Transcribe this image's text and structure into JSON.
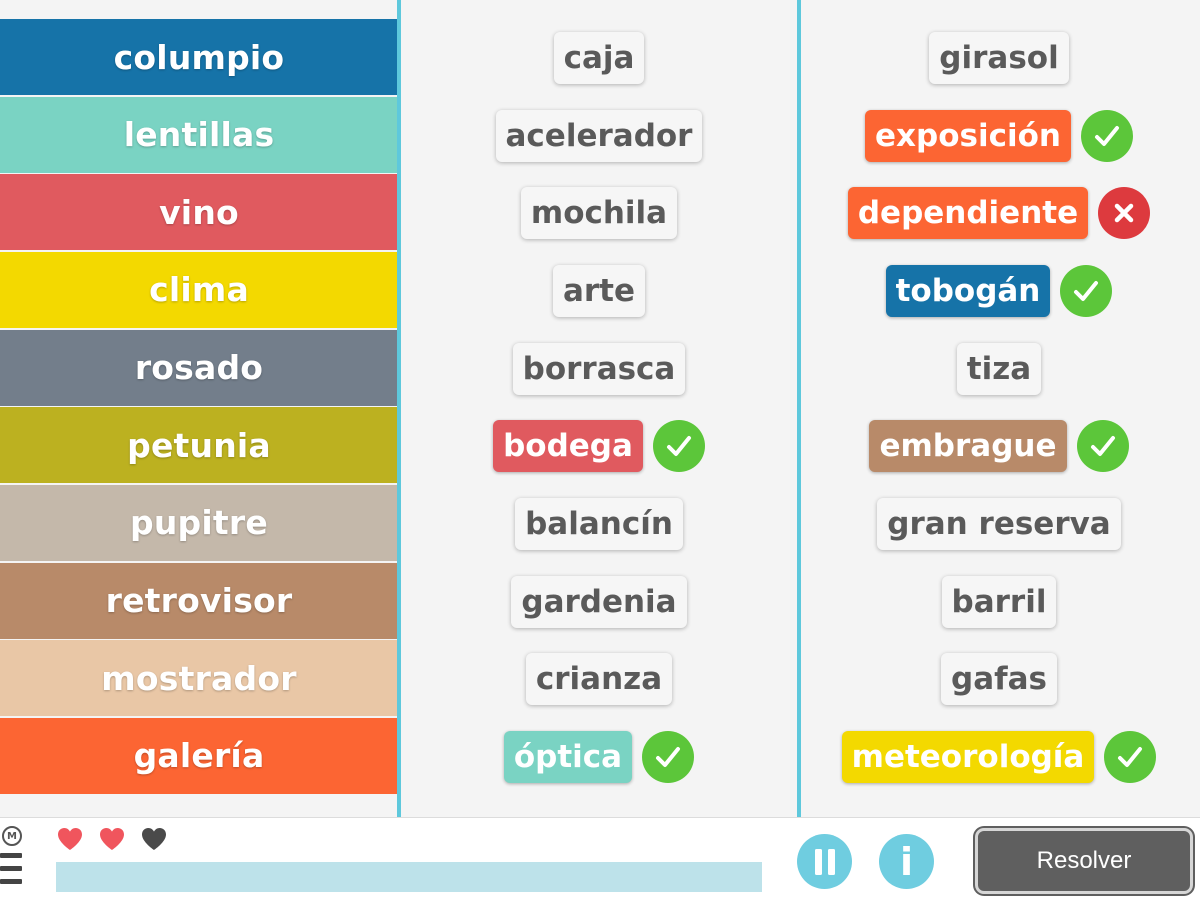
{
  "categories": [
    {
      "label": "columpio",
      "color": "#1673a8"
    },
    {
      "label": "lentillas",
      "color": "#7ad3c3"
    },
    {
      "label": "vino",
      "color": "#e05a5f"
    },
    {
      "label": "clima",
      "color": "#f3d900"
    },
    {
      "label": "rosado",
      "color": "#737e8b"
    },
    {
      "label": "petunia",
      "color": "#bcb120"
    },
    {
      "label": "pupitre",
      "color": "#c4b8aa"
    },
    {
      "label": "retrovisor",
      "color": "#b88a69"
    },
    {
      "label": "mostrador",
      "color": "#e9c7a6"
    },
    {
      "label": "galería",
      "color": "#fc6533"
    }
  ],
  "column_middle": [
    {
      "word": "caja"
    },
    {
      "word": "acelerador"
    },
    {
      "word": "mochila"
    },
    {
      "word": "arte"
    },
    {
      "word": "borrasca"
    },
    {
      "word": "bodega",
      "color": "#e05a5f",
      "mark": "check"
    },
    {
      "word": "balancín"
    },
    {
      "word": "gardenia"
    },
    {
      "word": "crianza"
    },
    {
      "word": "óptica",
      "color": "#7ad3c3",
      "mark": "check"
    }
  ],
  "column_right": [
    {
      "word": "girasol"
    },
    {
      "word": "exposición",
      "color": "#fc6533",
      "mark": "check"
    },
    {
      "word": "dependiente",
      "color": "#fc6533",
      "mark": "cross"
    },
    {
      "word": "tobogán",
      "color": "#1673a8",
      "mark": "check"
    },
    {
      "word": "tiza"
    },
    {
      "word": "embrague",
      "color": "#b88a69",
      "mark": "check"
    },
    {
      "word": "gran reserva"
    },
    {
      "word": "barril"
    },
    {
      "word": "gafas"
    },
    {
      "word": "meteorología",
      "color": "#f3d900",
      "mark": "check"
    }
  ],
  "bottom_bar": {
    "brand_letter": "M",
    "lives": [
      {
        "state": "full"
      },
      {
        "state": "full"
      },
      {
        "state": "empty"
      }
    ],
    "lives_colors": {
      "full": "#f0555d",
      "empty": "#4a4a4a"
    },
    "progress": 0.0,
    "pause_icon": "pause-icon",
    "info_label": "i",
    "resolve_label": "Resolver"
  }
}
